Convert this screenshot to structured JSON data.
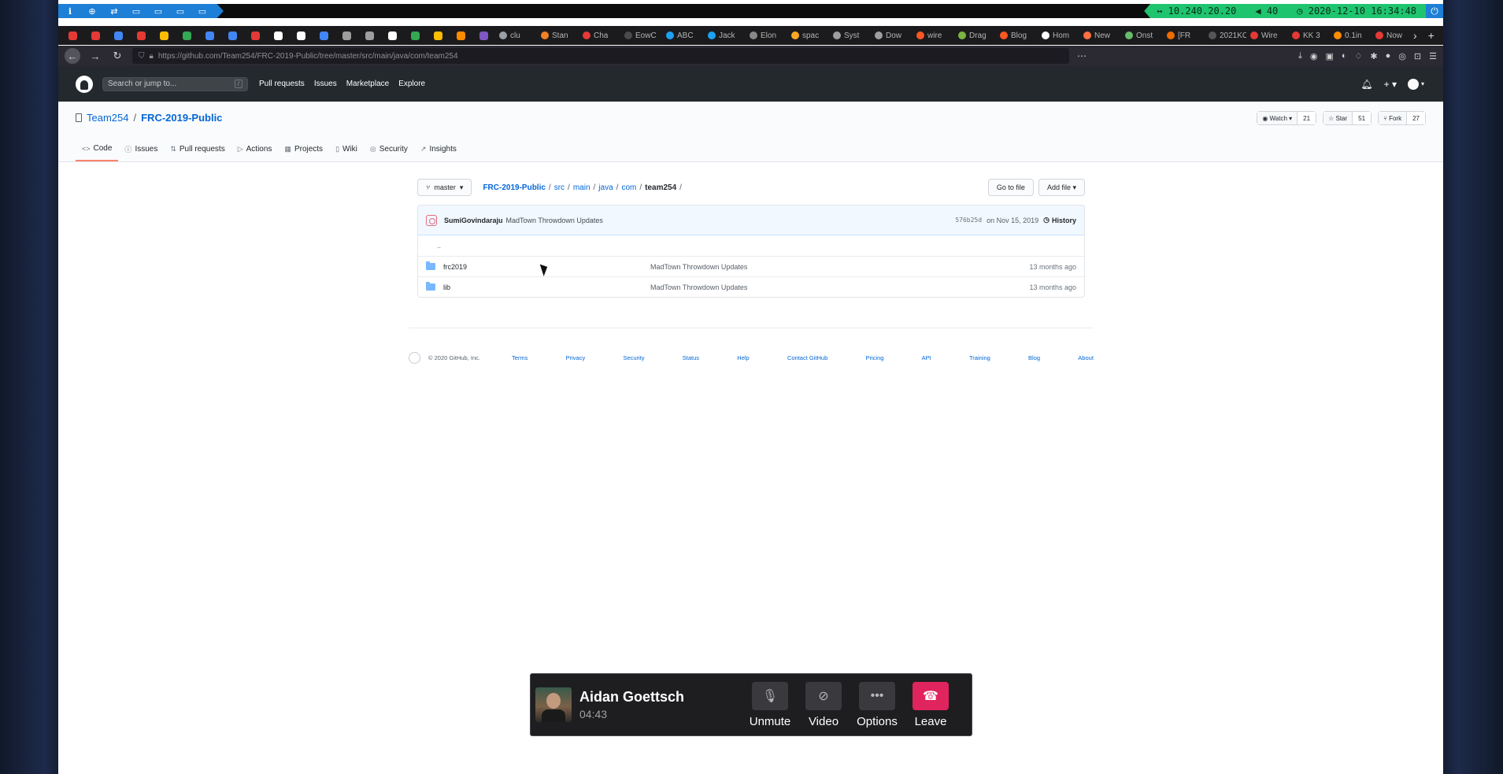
{
  "system_bar": {
    "launchers": [
      "ℹ",
      "⊕",
      "⇄",
      "▭",
      "▭",
      "▭",
      "▭"
    ],
    "ip": "↔ 10.240.20.20",
    "volume": "◀ 40",
    "datetime": "◷ 2020-12-10 16:34:48",
    "power": "⏻"
  },
  "browser": {
    "tabs": [
      {
        "label": "clu",
        "color": "#9aa0a6"
      },
      {
        "label": "Stan",
        "color": "#f48024"
      },
      {
        "label": "Cha",
        "color": "#e53935"
      },
      {
        "label": "EowC",
        "color": "#4a4a4a"
      },
      {
        "label": "ABC",
        "color": "#1da1f2"
      },
      {
        "label": "Jack",
        "color": "#1da1f2"
      },
      {
        "label": "Elon",
        "color": "#888888"
      },
      {
        "label": "spac",
        "color": "#f9a825"
      },
      {
        "label": "Syst",
        "color": "#9e9e9e"
      },
      {
        "label": "Dow",
        "color": "#9e9e9e"
      },
      {
        "label": "wire",
        "color": "#ff5722"
      },
      {
        "label": "Drag",
        "color": "#7cb342"
      },
      {
        "label": "Blog",
        "color": "#ff5722"
      },
      {
        "label": "Hom",
        "color": "#ffffff"
      },
      {
        "label": "New",
        "color": "#ff7043"
      },
      {
        "label": "Onst",
        "color": "#66bb6a"
      },
      {
        "label": "[FR",
        "color": "#ef6c00"
      },
      {
        "label": "2021KO",
        "color": "#555555"
      },
      {
        "label": "Wire",
        "color": "#e53935"
      },
      {
        "label": "KK 3",
        "color": "#e53935"
      },
      {
        "label": "0.1in",
        "color": "#fb8c00"
      },
      {
        "label": "Now",
        "color": "#e53935"
      }
    ],
    "pinned_colors": [
      "#e53935",
      "#e53935",
      "#4285f4",
      "#e53935",
      "#fbbc04",
      "#34a853",
      "#4285f4",
      "#4285f4",
      "#e53935",
      "#ffffff",
      "#ffffff",
      "#4285f4",
      "#9e9e9e",
      "#9e9e9e",
      "#ffffff",
      "#34a853",
      "#fbbc04",
      "#fb8c00",
      "#7e57c2"
    ],
    "url": "https://github.com/Team254/FRC-2019-Public/tree/master/src/main/java/com/team254"
  },
  "github": {
    "search_placeholder": "Search or jump to...",
    "search_key": "/",
    "nav": [
      "Pull requests",
      "Issues",
      "Marketplace",
      "Explore"
    ],
    "repo_owner": "Team254",
    "repo_name": "FRC-2019-Public",
    "watch": {
      "label": "Watch ▾",
      "count": "21"
    },
    "star": {
      "label": "Star",
      "count": "51"
    },
    "fork": {
      "label": "Fork",
      "count": "27"
    },
    "tabs": [
      {
        "icon": "<>",
        "label": "Code"
      },
      {
        "icon": "ⓘ",
        "label": "Issues"
      },
      {
        "icon": "⇅",
        "label": "Pull requests"
      },
      {
        "icon": "▷",
        "label": "Actions"
      },
      {
        "icon": "▦",
        "label": "Projects"
      },
      {
        "icon": "▯",
        "label": "Wiki"
      },
      {
        "icon": "◎",
        "label": "Security"
      },
      {
        "icon": "↗",
        "label": "Insights"
      }
    ]
  },
  "tree": {
    "branch": "master",
    "crumbs": [
      "FRC-2019-Public",
      "src",
      "main",
      "java",
      "com"
    ],
    "current": "team254",
    "goto_file": "Go to file",
    "add_file": "Add file ▾",
    "commit": {
      "author": "SumiGovindaraju",
      "message": "MadTown Throwdown Updates",
      "sha": "576b25d",
      "date": "on Nov 15, 2019",
      "history": "History"
    },
    "updir": "..",
    "files": [
      {
        "name": "frc2019",
        "message": "MadTown Throwdown Updates",
        "age": "13 months ago"
      },
      {
        "name": "lib",
        "message": "MadTown Throwdown Updates",
        "age": "13 months ago"
      }
    ]
  },
  "footer": {
    "copyright": "© 2020 GitHub, Inc.",
    "links": [
      "Terms",
      "Privacy",
      "Security",
      "Status",
      "Help",
      "Contact GitHub",
      "Pricing",
      "API",
      "Training",
      "Blog",
      "About"
    ]
  },
  "call": {
    "name": "Aidan Goettsch",
    "duration": "04:43",
    "unmute": "Unmute",
    "video": "Video",
    "options": "Options",
    "leave": "Leave"
  }
}
